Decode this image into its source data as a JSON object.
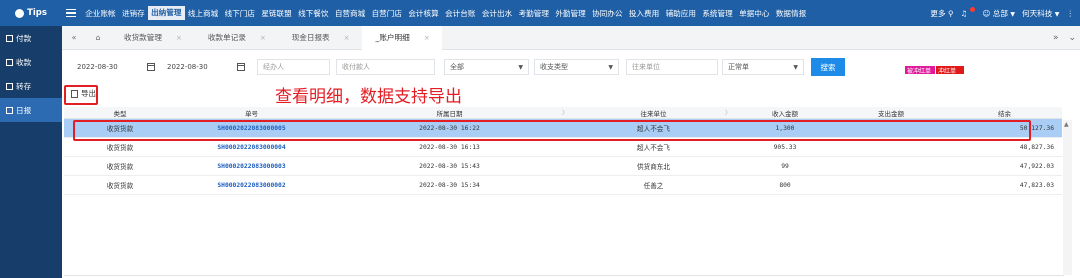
{
  "topbar": {
    "logo": "Tips",
    "nav": [
      "企业账帐",
      "进销存",
      "出纳管理",
      "线上商城",
      "线下门店",
      "星链联盟",
      "线下餐饮",
      "自营商城",
      "自营门店",
      "会计核算",
      "会计台账",
      "会计出水",
      "考勤管理",
      "外勤管理",
      "协同办公",
      "投入费用",
      "辅助应用",
      "系统管理",
      "单据中心",
      "数据情报"
    ],
    "active_index": 2,
    "more": "更多",
    "user": "总部",
    "company": "何天科技"
  },
  "sidebar": {
    "items": [
      {
        "label": "付款"
      },
      {
        "label": "收款"
      },
      {
        "label": "转存"
      },
      {
        "label": "日报"
      }
    ],
    "active_index": 3
  },
  "tabs": {
    "items": [
      {
        "label": "收货款管理"
      },
      {
        "label": "收款单记录"
      },
      {
        "label": "现金日报表"
      },
      {
        "label": "_账户明细"
      }
    ],
    "active_index": 3
  },
  "filters": {
    "date_from": "2022-08-30",
    "date_to": "2022-08-30",
    "handler_placeholder": "经办人",
    "payer_placeholder": "收付款人",
    "scope_value": "全部",
    "type_placeholder": "收支类型",
    "partner_placeholder": "往来单位",
    "doc_status": "正常单",
    "search_label": "搜索",
    "tag_reversed": "被冲红单",
    "tag_red": "冲红单"
  },
  "toolbar": {
    "export_label": "导出"
  },
  "annotation": {
    "text": "查看明细，数据支持导出"
  },
  "table": {
    "headers": [
      "类型",
      "单号",
      "所属日期",
      "往来单位",
      "收入金额",
      "支出金额",
      "结余"
    ],
    "rows": [
      {
        "type": "收货货款",
        "no": "SH0002022083000005",
        "date": "2022-08-30 16:22",
        "party": "超人不会飞",
        "income": "1,300",
        "expense": "",
        "balance": "50,127.36"
      },
      {
        "type": "收货货款",
        "no": "SH0002022083000004",
        "date": "2022-08-30 16:13",
        "party": "超人不会飞",
        "income": "905.33",
        "expense": "",
        "balance": "48,827.36"
      },
      {
        "type": "收货货款",
        "no": "SH0002022083000003",
        "date": "2022-08-30 15:43",
        "party": "供货商东北",
        "income": "99",
        "expense": "",
        "balance": "47,922.03"
      },
      {
        "type": "收货货款",
        "no": "SH0002022083000002",
        "date": "2022-08-30 15:34",
        "party": "任善之",
        "income": "800",
        "expense": "",
        "balance": "47,823.03"
      }
    ],
    "selected_index": 0
  },
  "colors": {
    "topbar": "#1f5fa5",
    "sidebar": "#173e6a",
    "accent": "#1e8be8",
    "annotation": "#e31d24",
    "selected_row": "#a9cdf5"
  }
}
